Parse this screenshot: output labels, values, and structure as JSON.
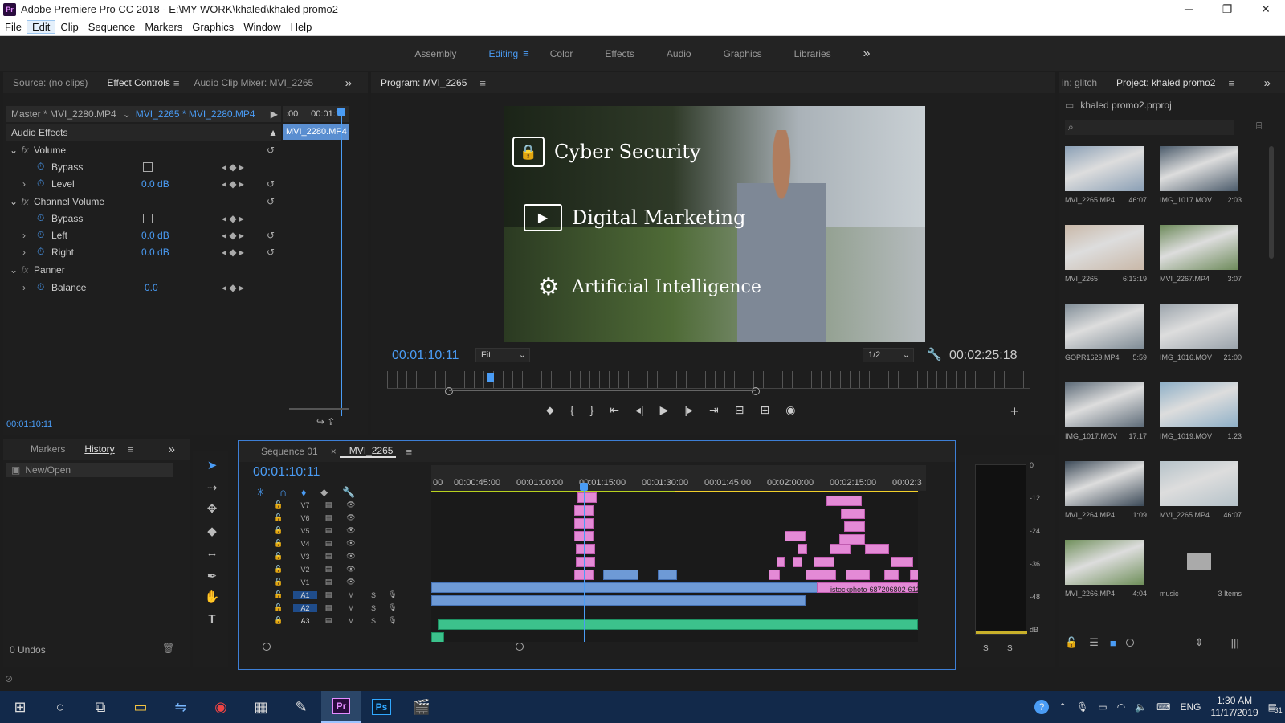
{
  "window": {
    "title": "Adobe Premiere Pro CC 2018 - E:\\MY WORK\\khaled\\khaled promo2",
    "app_badge": "Pr"
  },
  "menu": [
    "File",
    "Edit",
    "Clip",
    "Sequence",
    "Markers",
    "Graphics",
    "Window",
    "Help"
  ],
  "workspaces": [
    "Assembly",
    "Editing",
    "Color",
    "Effects",
    "Audio",
    "Graphics",
    "Libraries"
  ],
  "workspace_more": "»",
  "source_panel": {
    "tabs": [
      "Source: (no clips)",
      "Effect Controls",
      "Audio Clip Mixer: MVI_2265"
    ],
    "master_label": "Master * MVI_2280.MP4",
    "clip_label": "MVI_2265 * MVI_2280.MP4",
    "ruler_start": ":00",
    "ruler_mark": "00:01:15",
    "mini_clip": "MVI_2280.MP4",
    "section": "Audio Effects",
    "effects": [
      {
        "name": "Volume",
        "fx": "fx"
      },
      {
        "name": "Bypass"
      },
      {
        "name": "Level",
        "value": "0.0 dB"
      },
      {
        "name": "Channel Volume",
        "fx": "fx"
      },
      {
        "name": "Bypass"
      },
      {
        "name": "Left",
        "value": "0.0 dB"
      },
      {
        "name": "Right",
        "value": "0.0 dB"
      },
      {
        "name": "Panner",
        "fx": "fx"
      },
      {
        "name": "Balance",
        "value": "0.0"
      }
    ],
    "timecode": "00:01:10:11"
  },
  "program": {
    "tab": "Program: MVI_2265",
    "overlay": [
      "Cyber Security",
      "Digital Marketing",
      "Artificial Intelligence"
    ],
    "timecode": "00:01:10:11",
    "fit": "Fit",
    "resolution": "1/2",
    "duration": "00:02:25:18"
  },
  "project": {
    "tabs": [
      "in: glitch",
      "Project: khaled promo2"
    ],
    "file": "khaled promo2.prproj",
    "items": [
      {
        "name": "MVI_2265.MP4",
        "dur": "46:07",
        "color": "#8a9fb5"
      },
      {
        "name": "IMG_1017.MOV",
        "dur": "2:03",
        "color": "#4a5a6a"
      },
      {
        "name": "MVI_2265",
        "dur": "6:13:19",
        "color": "#c9b8a8"
      },
      {
        "name": "MVI_2267.MP4",
        "dur": "3:07",
        "color": "#6d8a5a"
      },
      {
        "name": "GOPR1629.MP4",
        "dur": "5:59",
        "color": "#7f8c96"
      },
      {
        "name": "IMG_1016.MOV",
        "dur": "21:00",
        "color": "#9aa3ab"
      },
      {
        "name": "IMG_1017.MOV",
        "dur": "17:17",
        "color": "#5d6b78"
      },
      {
        "name": "IMG_1019.MOV",
        "dur": "1:23",
        "color": "#8dafc7"
      },
      {
        "name": "MVI_2264.MP4",
        "dur": "1:09",
        "color": "#3c4a58"
      },
      {
        "name": "MVI_2265.MP4",
        "dur": "46:07",
        "color": "#b5c2c9"
      },
      {
        "name": "MVI_2266.MP4",
        "dur": "4:04",
        "color": "#6f8f5a"
      },
      {
        "name": "music",
        "dur": "3 Items",
        "color": "#2e2e2e"
      }
    ]
  },
  "history": {
    "tabs": [
      "Markers",
      "History"
    ],
    "item": "New/Open",
    "undos": "0 Undos"
  },
  "timeline": {
    "tabs": [
      "Sequence 01",
      "MVI_2265"
    ],
    "timecode": "00:01:10:11",
    "ruler": [
      "00",
      "00:00:45:00",
      "00:01:00:00",
      "00:01:15:00",
      "00:01:30:00",
      "00:01:45:00",
      "00:02:00:00",
      "00:02:15:00",
      "00:02:3"
    ],
    "video_tracks": [
      "V7",
      "V6",
      "V5",
      "V4",
      "V3",
      "V2",
      "V1"
    ],
    "audio_tracks": [
      "A1",
      "A2",
      "A3"
    ],
    "clip_label": "istockphoto-687206802-612",
    "meter_scale": [
      "0",
      "-12",
      "-24",
      "-36",
      "-48",
      "dB"
    ],
    "meter_solo": [
      "S",
      "S"
    ]
  },
  "taskbar": {
    "lang": "ENG",
    "time": "1:30 AM",
    "date": "11/17/2019",
    "notif": "31"
  }
}
